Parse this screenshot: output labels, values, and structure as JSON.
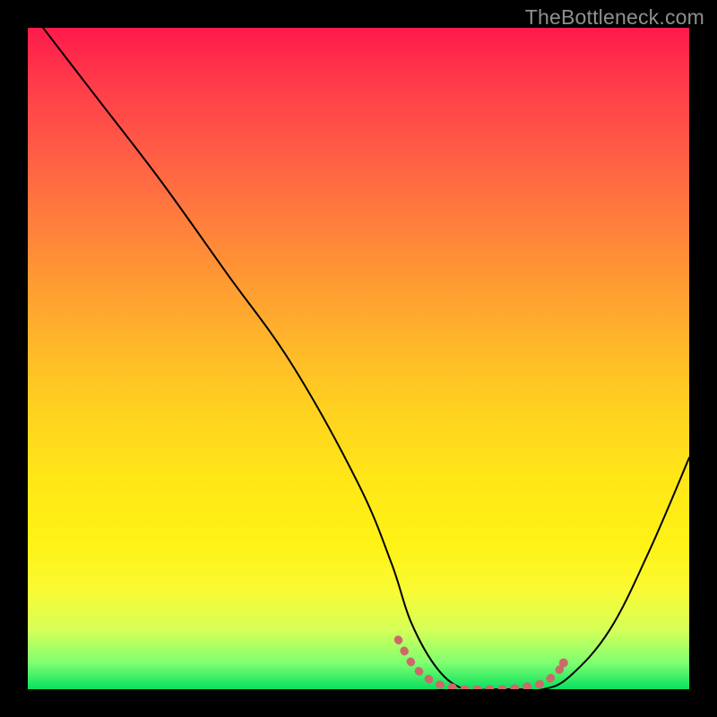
{
  "watermark": "TheBottleneck.com",
  "chart_data": {
    "type": "line",
    "title": "",
    "xlabel": "",
    "ylabel": "",
    "xlim": [
      0,
      100
    ],
    "ylim": [
      0,
      100
    ],
    "grid": false,
    "series": [
      {
        "name": "bottleneck-curve",
        "color": "#000000",
        "x": [
          0,
          10,
          20,
          30,
          40,
          50,
          55,
          58,
          62,
          66,
          70,
          74,
          78,
          82,
          88,
          94,
          100
        ],
        "values": [
          103,
          90,
          77,
          63,
          49,
          31,
          19,
          10,
          3,
          0,
          0,
          0,
          0,
          2,
          9,
          21,
          35
        ]
      },
      {
        "name": "optimal-band",
        "color": "#cc6a6a",
        "x": [
          56,
          58,
          60,
          62,
          64,
          66,
          68,
          70,
          72,
          74,
          76,
          78,
          80,
          81
        ],
        "values": [
          7.5,
          4.0,
          2.0,
          0.8,
          0.3,
          0.0,
          0.0,
          0.0,
          0.0,
          0.2,
          0.5,
          1.0,
          2.5,
          4.0
        ]
      }
    ],
    "optimal_marker": {
      "x": 81,
      "y": 4.0,
      "color": "#cc6a6a"
    },
    "background_gradient": {
      "top": "#ff1a4b",
      "mid": "#ffd21f",
      "bottom": "#09e060"
    }
  }
}
